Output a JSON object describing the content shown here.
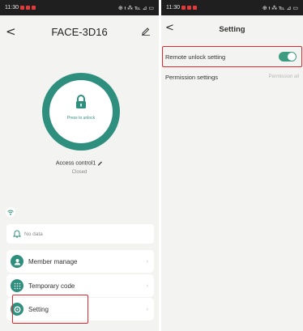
{
  "left": {
    "status": {
      "time": "11:30",
      "icons": "⊕ ᵻ ⁂ ℡ ⊿ ▭"
    },
    "header": {
      "title": "FACE-3D16"
    },
    "unlock": {
      "label": "Press to unlock"
    },
    "device": {
      "name": "Access control1",
      "status": "Closed"
    },
    "records": {
      "empty_label": "No data"
    },
    "menu": [
      {
        "label": "Member manage",
        "icon": "person-icon"
      },
      {
        "label": "Temporary code",
        "icon": "keypad-icon"
      },
      {
        "label": "Setting",
        "icon": "gear-icon"
      }
    ],
    "chevron": "›"
  },
  "right": {
    "status": {
      "time": "11:30",
      "icons": "⊕ ᵻ ⁂ ℡ ⊿ ▭"
    },
    "header": {
      "title": "Setting"
    },
    "rows": {
      "remote_unlock": {
        "label": "Remote unlock setting",
        "enabled": true
      },
      "permission": {
        "label": "Permission settings",
        "value": "Permission all"
      }
    },
    "chevron": "›"
  },
  "colors": {
    "accent": "#2f8f7e",
    "toggle": "#3c9b80",
    "highlight": "#e0282e"
  },
  "back_glyph": "<"
}
